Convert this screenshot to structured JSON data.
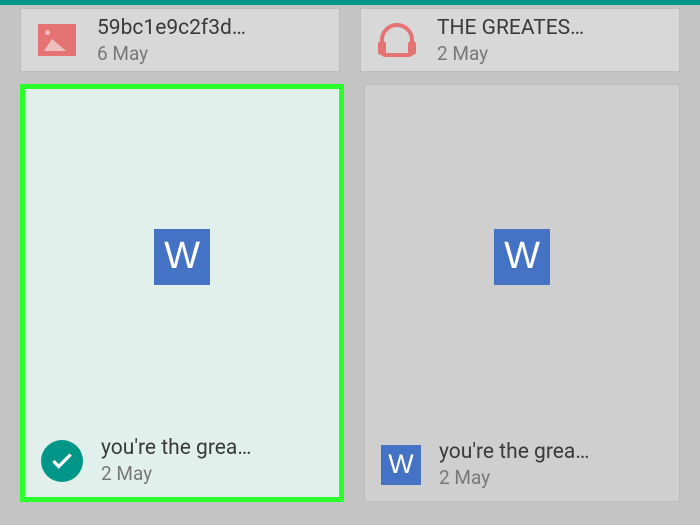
{
  "files": {
    "top": [
      {
        "title": "59bc1e9c2f3d…",
        "date": "6 May",
        "icon": "image"
      },
      {
        "title": "THE GREATES…",
        "date": "2 May",
        "icon": "audio"
      }
    ],
    "big": [
      {
        "title": "you're the grea…",
        "date": "2 May",
        "selected": true
      },
      {
        "title": "you're the grea…",
        "date": "2 May",
        "selected": false
      }
    ]
  }
}
